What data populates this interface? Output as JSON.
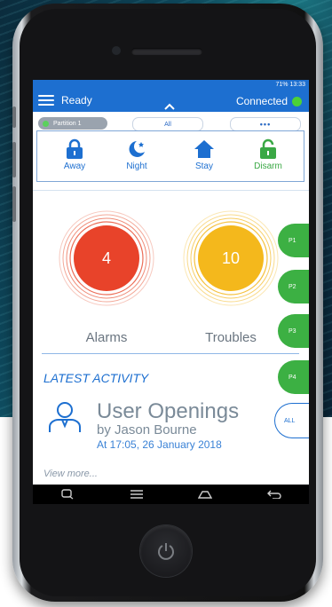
{
  "statusbar": {
    "text": "71% 13:33"
  },
  "appbar": {
    "status": "Ready",
    "connection": "Connected",
    "chevron": "^"
  },
  "partitions": {
    "selected": "Partition 1",
    "all": "All",
    "more": "•••"
  },
  "arm": [
    {
      "label": "Away",
      "icon": "lock-icon"
    },
    {
      "label": "Night",
      "icon": "moon-stars-icon"
    },
    {
      "label": "Stay",
      "icon": "house-icon"
    },
    {
      "label": "Disarm",
      "icon": "unlock-icon"
    }
  ],
  "counters": {
    "alarms": {
      "value": "4",
      "label": "Alarms",
      "color": "#e8432a"
    },
    "troubles": {
      "value": "10",
      "label": "Troubles",
      "color": "#f4b81c"
    }
  },
  "side_tabs": [
    "P1",
    "P2",
    "P3",
    "P4"
  ],
  "activity": {
    "heading": "LATEST ACTIVITY",
    "title": "User Openings",
    "by": "by Jason Bourne",
    "time": "At 17:05, 26 January 2018",
    "all": "ALL",
    "view_more": "View more..."
  },
  "colors": {
    "primary": "#1d6fd0",
    "green": "#3cb043"
  }
}
